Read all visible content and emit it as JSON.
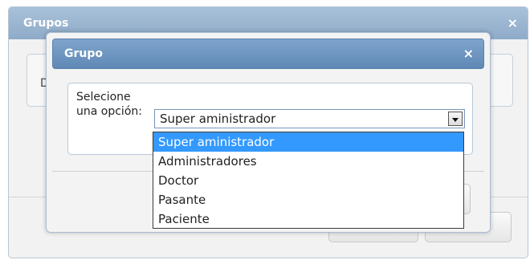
{
  "background_dialog": {
    "title": "Grupos",
    "close_glyph": "×",
    "panel_label": "D"
  },
  "dialog": {
    "title": "Grupo",
    "close_glyph": "×",
    "field_label": "Selecione una opción:",
    "select": {
      "value": "Super aministrador",
      "options": [
        "Super aministrador",
        "Administradores",
        "Doctor",
        "Pasante",
        "Paciente"
      ],
      "selected_index": 0
    }
  },
  "colors": {
    "titlebar": "#6f97c1",
    "selected_option": "#3399ff"
  }
}
